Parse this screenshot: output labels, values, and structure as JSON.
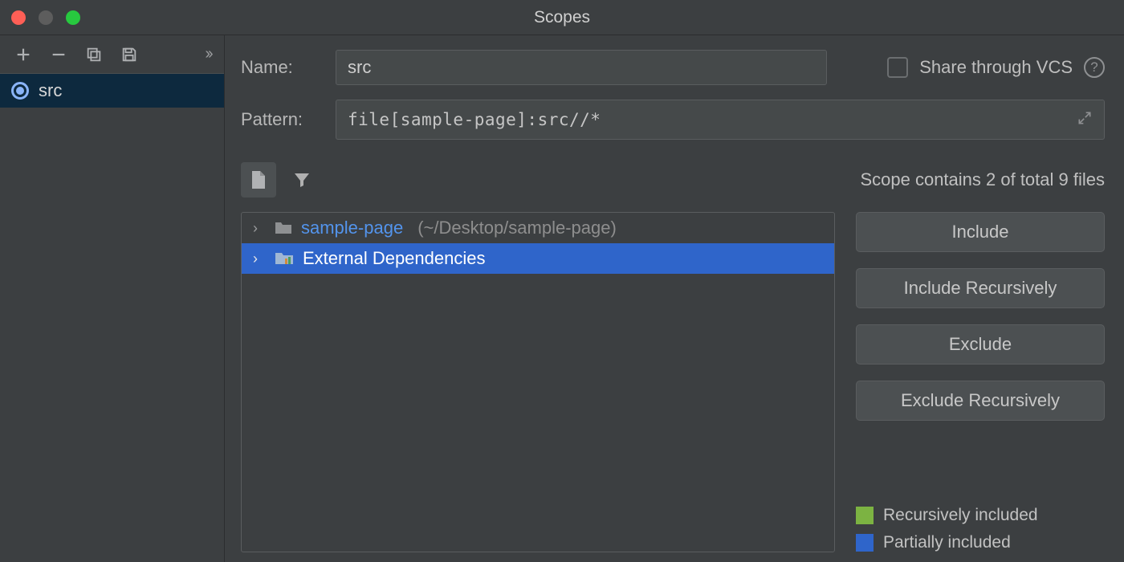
{
  "title": "Scopes",
  "sidebar": {
    "items": [
      {
        "label": "src"
      }
    ]
  },
  "form": {
    "name_label": "Name:",
    "name_value": "src",
    "share_label": "Share through VCS",
    "pattern_label": "Pattern:",
    "pattern_value": "file[sample-page]:src//*"
  },
  "status": {
    "text": "Scope contains 2 of total 9 files"
  },
  "tree": {
    "rows": [
      {
        "name": "sample-page",
        "path": "(~/Desktop/sample-page)",
        "selected": false
      },
      {
        "name": "External Dependencies",
        "path": "",
        "selected": true
      }
    ]
  },
  "buttons": {
    "include": "Include",
    "include_rec": "Include Recursively",
    "exclude": "Exclude",
    "exclude_rec": "Exclude Recursively"
  },
  "legend": {
    "rec": "Recursively included",
    "part": "Partially included",
    "colors": {
      "rec": "#7cb342",
      "part": "#2f65ca"
    }
  }
}
